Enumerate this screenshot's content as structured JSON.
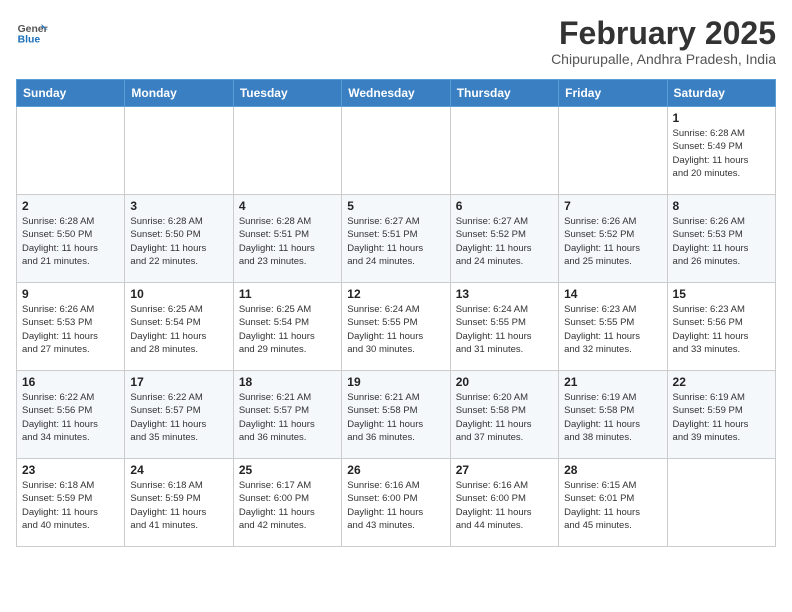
{
  "header": {
    "logo": {
      "general": "General",
      "blue": "Blue"
    },
    "title": "February 2025",
    "location": "Chipurupalle, Andhra Pradesh, India"
  },
  "weekdays": [
    "Sunday",
    "Monday",
    "Tuesday",
    "Wednesday",
    "Thursday",
    "Friday",
    "Saturday"
  ],
  "weeks": [
    [
      {
        "day": "",
        "info": ""
      },
      {
        "day": "",
        "info": ""
      },
      {
        "day": "",
        "info": ""
      },
      {
        "day": "",
        "info": ""
      },
      {
        "day": "",
        "info": ""
      },
      {
        "day": "",
        "info": ""
      },
      {
        "day": "1",
        "info": "Sunrise: 6:28 AM\nSunset: 5:49 PM\nDaylight: 11 hours\nand 20 minutes."
      }
    ],
    [
      {
        "day": "2",
        "info": "Sunrise: 6:28 AM\nSunset: 5:50 PM\nDaylight: 11 hours\nand 21 minutes."
      },
      {
        "day": "3",
        "info": "Sunrise: 6:28 AM\nSunset: 5:50 PM\nDaylight: 11 hours\nand 22 minutes."
      },
      {
        "day": "4",
        "info": "Sunrise: 6:28 AM\nSunset: 5:51 PM\nDaylight: 11 hours\nand 23 minutes."
      },
      {
        "day": "5",
        "info": "Sunrise: 6:27 AM\nSunset: 5:51 PM\nDaylight: 11 hours\nand 24 minutes."
      },
      {
        "day": "6",
        "info": "Sunrise: 6:27 AM\nSunset: 5:52 PM\nDaylight: 11 hours\nand 24 minutes."
      },
      {
        "day": "7",
        "info": "Sunrise: 6:26 AM\nSunset: 5:52 PM\nDaylight: 11 hours\nand 25 minutes."
      },
      {
        "day": "8",
        "info": "Sunrise: 6:26 AM\nSunset: 5:53 PM\nDaylight: 11 hours\nand 26 minutes."
      }
    ],
    [
      {
        "day": "9",
        "info": "Sunrise: 6:26 AM\nSunset: 5:53 PM\nDaylight: 11 hours\nand 27 minutes."
      },
      {
        "day": "10",
        "info": "Sunrise: 6:25 AM\nSunset: 5:54 PM\nDaylight: 11 hours\nand 28 minutes."
      },
      {
        "day": "11",
        "info": "Sunrise: 6:25 AM\nSunset: 5:54 PM\nDaylight: 11 hours\nand 29 minutes."
      },
      {
        "day": "12",
        "info": "Sunrise: 6:24 AM\nSunset: 5:55 PM\nDaylight: 11 hours\nand 30 minutes."
      },
      {
        "day": "13",
        "info": "Sunrise: 6:24 AM\nSunset: 5:55 PM\nDaylight: 11 hours\nand 31 minutes."
      },
      {
        "day": "14",
        "info": "Sunrise: 6:23 AM\nSunset: 5:55 PM\nDaylight: 11 hours\nand 32 minutes."
      },
      {
        "day": "15",
        "info": "Sunrise: 6:23 AM\nSunset: 5:56 PM\nDaylight: 11 hours\nand 33 minutes."
      }
    ],
    [
      {
        "day": "16",
        "info": "Sunrise: 6:22 AM\nSunset: 5:56 PM\nDaylight: 11 hours\nand 34 minutes."
      },
      {
        "day": "17",
        "info": "Sunrise: 6:22 AM\nSunset: 5:57 PM\nDaylight: 11 hours\nand 35 minutes."
      },
      {
        "day": "18",
        "info": "Sunrise: 6:21 AM\nSunset: 5:57 PM\nDaylight: 11 hours\nand 36 minutes."
      },
      {
        "day": "19",
        "info": "Sunrise: 6:21 AM\nSunset: 5:58 PM\nDaylight: 11 hours\nand 36 minutes."
      },
      {
        "day": "20",
        "info": "Sunrise: 6:20 AM\nSunset: 5:58 PM\nDaylight: 11 hours\nand 37 minutes."
      },
      {
        "day": "21",
        "info": "Sunrise: 6:19 AM\nSunset: 5:58 PM\nDaylight: 11 hours\nand 38 minutes."
      },
      {
        "day": "22",
        "info": "Sunrise: 6:19 AM\nSunset: 5:59 PM\nDaylight: 11 hours\nand 39 minutes."
      }
    ],
    [
      {
        "day": "23",
        "info": "Sunrise: 6:18 AM\nSunset: 5:59 PM\nDaylight: 11 hours\nand 40 minutes."
      },
      {
        "day": "24",
        "info": "Sunrise: 6:18 AM\nSunset: 5:59 PM\nDaylight: 11 hours\nand 41 minutes."
      },
      {
        "day": "25",
        "info": "Sunrise: 6:17 AM\nSunset: 6:00 PM\nDaylight: 11 hours\nand 42 minutes."
      },
      {
        "day": "26",
        "info": "Sunrise: 6:16 AM\nSunset: 6:00 PM\nDaylight: 11 hours\nand 43 minutes."
      },
      {
        "day": "27",
        "info": "Sunrise: 6:16 AM\nSunset: 6:00 PM\nDaylight: 11 hours\nand 44 minutes."
      },
      {
        "day": "28",
        "info": "Sunrise: 6:15 AM\nSunset: 6:01 PM\nDaylight: 11 hours\nand 45 minutes."
      },
      {
        "day": "",
        "info": ""
      }
    ]
  ]
}
